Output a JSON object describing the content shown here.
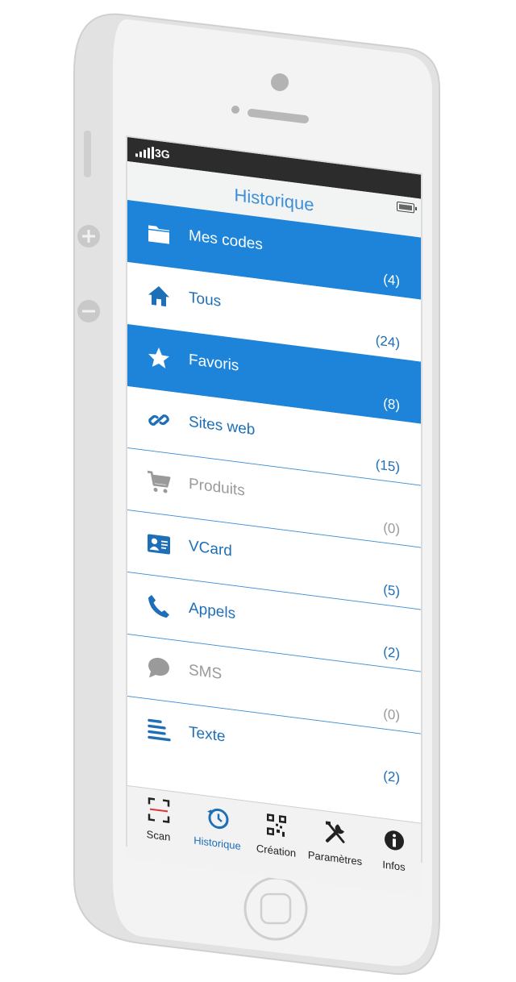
{
  "status_bar": {
    "network": "3G"
  },
  "nav": {
    "title": "Historique"
  },
  "list": [
    {
      "label": "Mes codes",
      "count": "(4)",
      "icon": "folder-icon",
      "selected": true
    },
    {
      "label": "Tous",
      "count": "(24)",
      "icon": "home-icon",
      "selected": false
    },
    {
      "label": "Favoris",
      "count": "(8)",
      "icon": "star-icon",
      "selected": true
    },
    {
      "label": "Sites web",
      "count": "(15)",
      "icon": "link-icon",
      "selected": false
    },
    {
      "label": "Produits",
      "count": "(0)",
      "icon": "cart-icon",
      "selected": false,
      "disabled": true
    },
    {
      "label": "VCard",
      "count": "(5)",
      "icon": "contact-card-icon",
      "selected": false
    },
    {
      "label": "Appels",
      "count": "(2)",
      "icon": "phone-icon",
      "selected": false
    },
    {
      "label": "SMS",
      "count": "(0)",
      "icon": "chat-bubble-icon",
      "selected": false,
      "disabled": true
    },
    {
      "label": "Texte",
      "count": "(2)",
      "icon": "text-lines-icon",
      "selected": false
    }
  ],
  "tabs": [
    {
      "label": "Scan",
      "icon": "scan-frame-icon"
    },
    {
      "label": "Historique",
      "icon": "history-clock-icon",
      "active": true
    },
    {
      "label": "Création",
      "icon": "qr-code-icon"
    },
    {
      "label": "Paramètres",
      "icon": "tools-icon"
    },
    {
      "label": "Infos",
      "icon": "info-icon"
    }
  ],
  "colors": {
    "accent": "#1d84d9",
    "text_blue": "#1d6fb8",
    "disabled": "#9a9a9a",
    "status_bar": "#2c2c2c"
  }
}
